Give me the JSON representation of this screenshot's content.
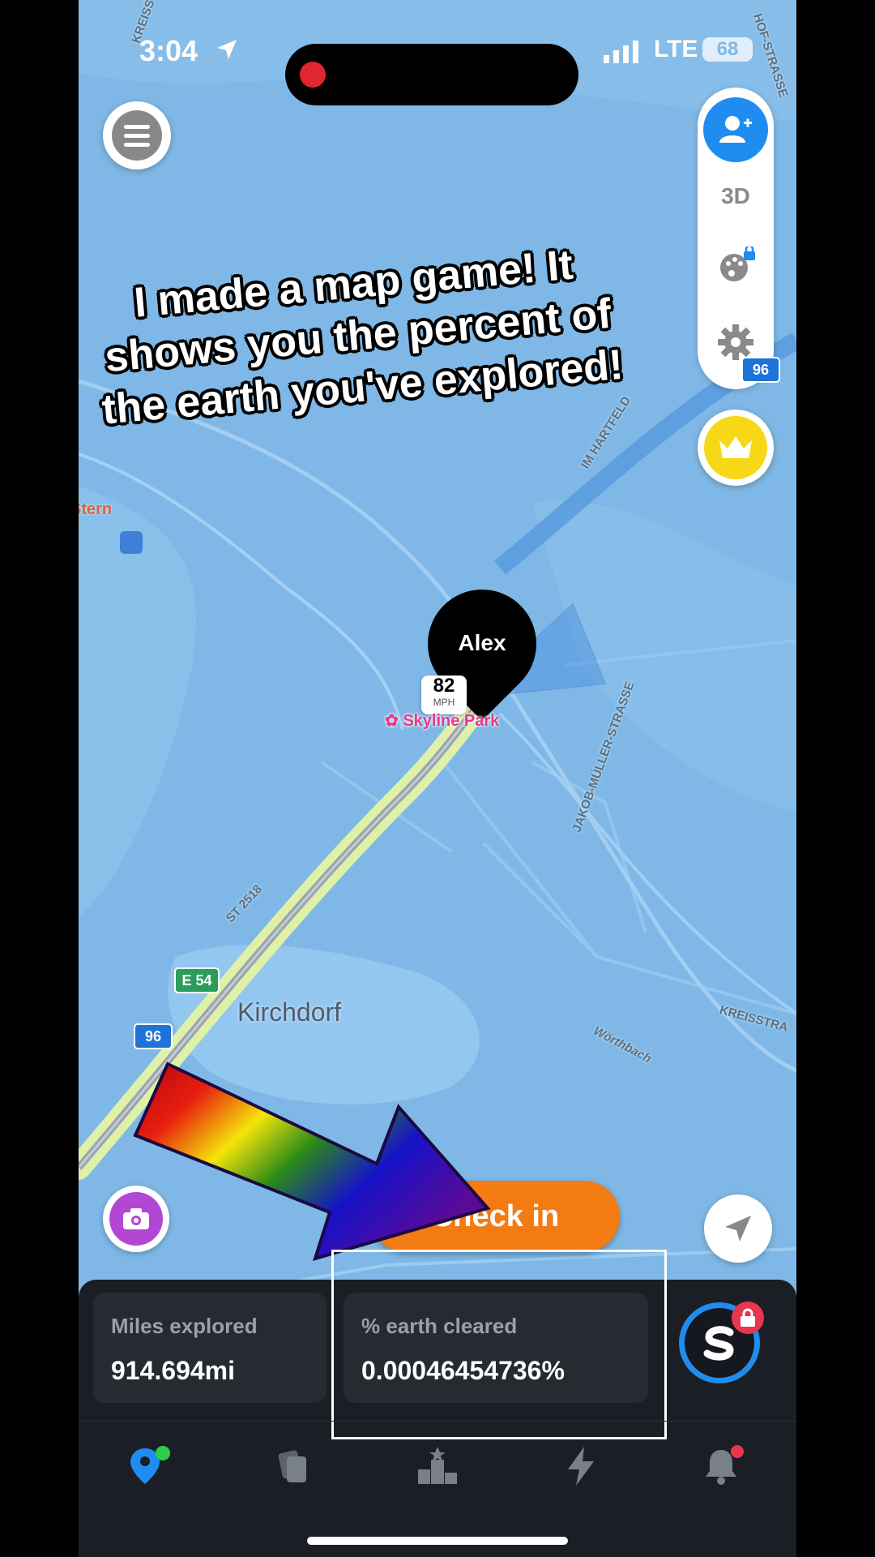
{
  "status_bar": {
    "time": "3:04",
    "network": "LTE",
    "battery": "68"
  },
  "caption": "I made a map game! It shows you the percent of the earth you've explored!",
  "side_controls": {
    "view_3d_label": "3D"
  },
  "map": {
    "user_pin": {
      "name": "Alex",
      "speed": "82",
      "speed_unit": "MPH"
    },
    "poi_label": "Skyline Park",
    "place_labels": {
      "town": "Kirchdorf",
      "stern": "Stern",
      "kreisstrasse_right": "KREISSTRA",
      "kreisstrasse_top": "KREISS",
      "hofstrasse": "HOF-STRASSE",
      "im_hartfeld": "IM HARTFELD",
      "jakob_mueller": "JAKOB-MÜLLER-STRASSE",
      "st2518": "ST 2518",
      "woerthbach": "Wörthbach"
    },
    "road_shields": {
      "e54": "E 54",
      "a96_bottom": "96",
      "a96_top": "96"
    }
  },
  "actions": {
    "check_in_label": "Check in"
  },
  "stats": {
    "miles_label": "Miles explored",
    "miles_value": "914.694mi",
    "earth_label": "% earth cleared",
    "earth_value": "0.00046454736%"
  },
  "colors": {
    "accent_blue": "#1e8cf0",
    "check_in_orange": "#f47a12",
    "crown_yellow": "#f7d816",
    "camera_purple": "#b247d6"
  }
}
